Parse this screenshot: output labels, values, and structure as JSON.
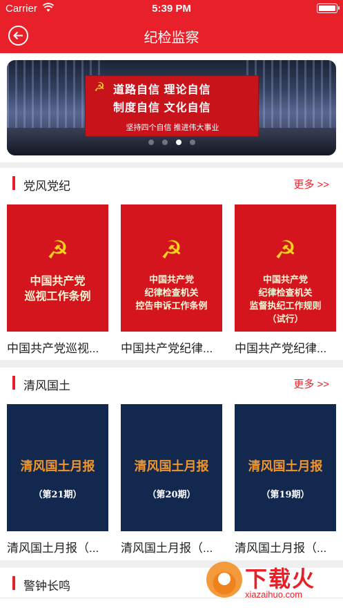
{
  "status_bar": {
    "carrier": "Carrier",
    "time": "5:39 PM"
  },
  "navbar": {
    "title": "纪检监察"
  },
  "banner": {
    "line1": "道路自信  理论自信",
    "line2": "制度自信  文化自信",
    "slogan": "坚持四个自信 推进伟大事业",
    "dots": 4,
    "active_dot": 3
  },
  "sections": [
    {
      "title": "党风党纪",
      "more": "更多 >>",
      "items": [
        {
          "cover_lines": [
            "中国共产党",
            "巡视工作条例"
          ],
          "caption": "中国共产党巡视..."
        },
        {
          "cover_lines": [
            "中国共产党",
            "纪律检查机关",
            "控告申诉工作条例"
          ],
          "caption": "中国共产党纪律..."
        },
        {
          "cover_lines": [
            "中国共产党",
            "纪律检查机关",
            "监督执纪工作规则",
            "（试行）"
          ],
          "caption": "中国共产党纪律..."
        }
      ]
    },
    {
      "title": "清风国土",
      "more": "更多 >>",
      "items": [
        {
          "cover_title": "清风国土月报",
          "cover_issue": "（第21期）",
          "caption": "清风国土月报（..."
        },
        {
          "cover_title": "清风国土月报",
          "cover_issue": "（第20期）",
          "caption": "清风国土月报（..."
        },
        {
          "cover_title": "清风国土月报",
          "cover_issue": "（第19期）",
          "caption": "清风国土月报（..."
        }
      ]
    },
    {
      "title": "警钟长鸣"
    }
  ],
  "watermark": {
    "brand": "下载火",
    "site": "xiazaihuo.com"
  },
  "colors": {
    "primary_red": "#e8202a",
    "cover_red": "#d4151e",
    "cover_navy": "#13284f",
    "accent_gold": "#f7d21a"
  }
}
